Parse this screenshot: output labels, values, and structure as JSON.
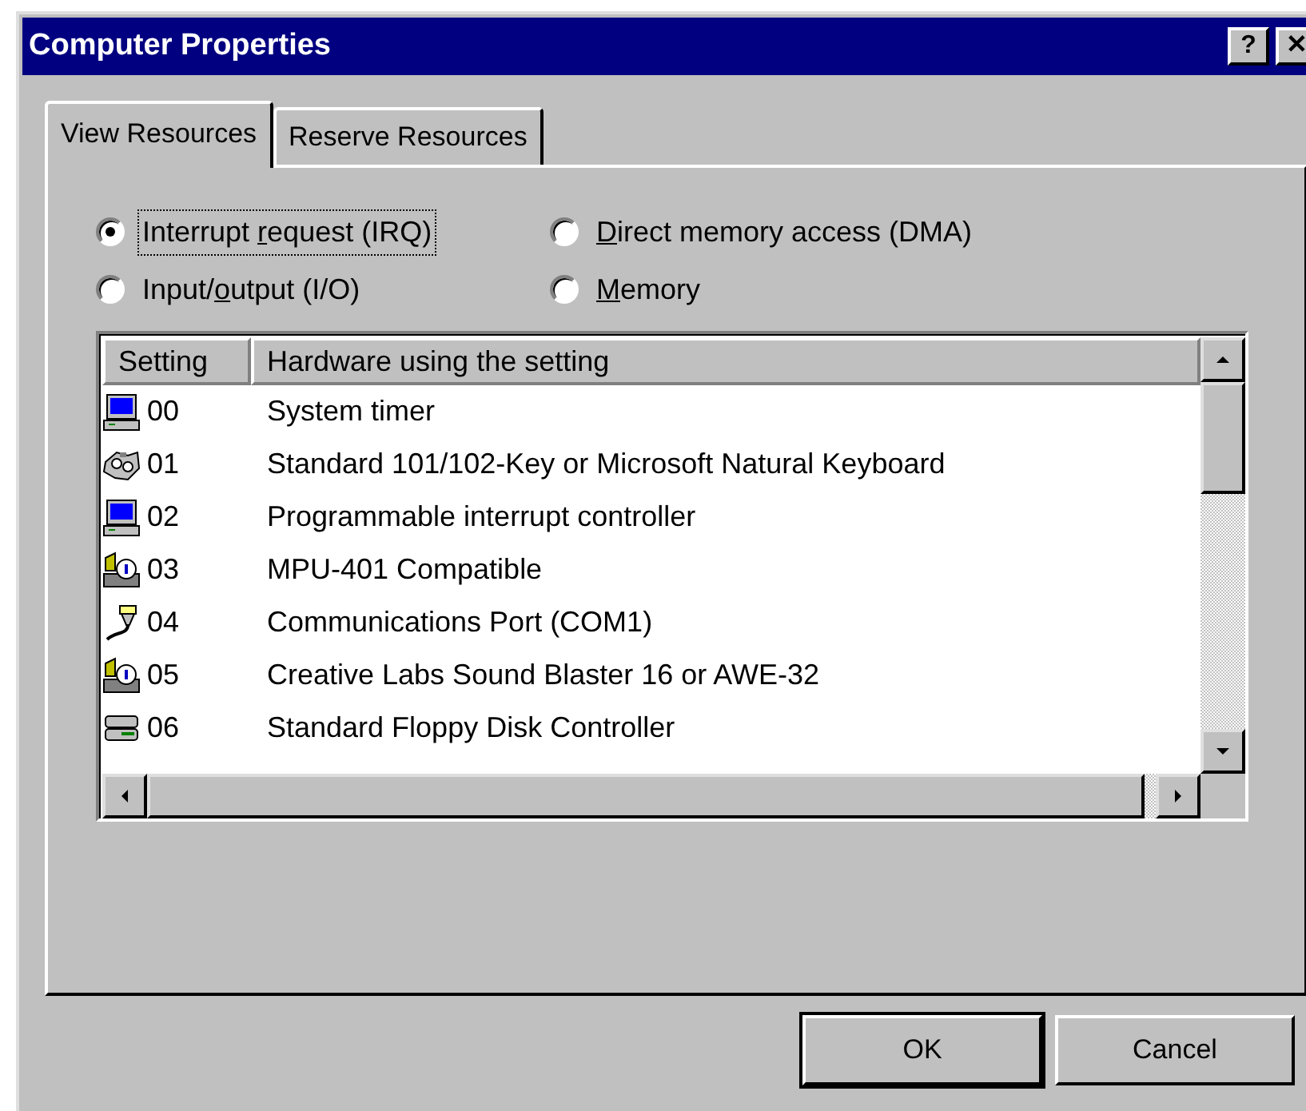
{
  "window": {
    "title": "Computer Properties",
    "help_button": "?",
    "close_button": "✕"
  },
  "tabs": [
    {
      "label": "View Resources",
      "selected": true
    },
    {
      "label": "Reserve Resources",
      "selected": false
    }
  ],
  "resource_types": [
    {
      "before": "Interrupt ",
      "access_key": "r",
      "after": "equest (IRQ)",
      "selected": true
    },
    {
      "access_key": "D",
      "after": "irect memory access (DMA)",
      "selected": false
    },
    {
      "before": "Input/",
      "access_key": "o",
      "after": "utput (I/O)",
      "selected": false
    },
    {
      "access_key": "M",
      "after": "emory",
      "selected": false
    }
  ],
  "table": {
    "columns": [
      "Setting",
      "Hardware using the setting"
    ],
    "rows": [
      {
        "kind": "system",
        "setting": "00",
        "hardware": "System timer"
      },
      {
        "kind": "keyboard",
        "setting": "01",
        "hardware": "Standard 101/102-Key or Microsoft Natural Keyboard"
      },
      {
        "kind": "system",
        "setting": "02",
        "hardware": "Programmable interrupt controller"
      },
      {
        "kind": "sound",
        "setting": "03",
        "hardware": "MPU-401 Compatible"
      },
      {
        "kind": "port",
        "setting": "04",
        "hardware": "Communications Port (COM1)"
      },
      {
        "kind": "sound",
        "setting": "05",
        "hardware": "Creative Labs Sound Blaster 16 or AWE-32"
      },
      {
        "kind": "disk",
        "setting": "06",
        "hardware": "Standard Floppy Disk Controller"
      }
    ]
  },
  "buttons": [
    "OK",
    "Cancel"
  ]
}
